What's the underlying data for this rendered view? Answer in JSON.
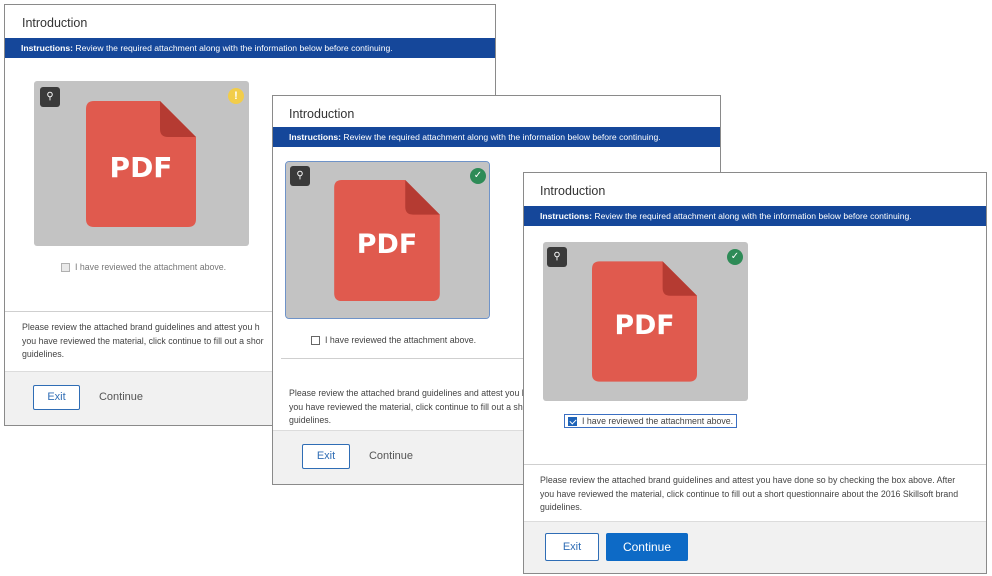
{
  "window_title": "Introduction",
  "instructions_label": "Instructions:",
  "instructions_text": " Review the required attachment along with the information below before continuing.",
  "pdf_label": "PDF",
  "checkbox_label": "I have reviewed the attachment above.",
  "description_w1": "Please review the attached brand guidelines and attest you h\nyou have reviewed the material, click continue to fill out a shor\nguidelines.",
  "description_w2": "Please review the attached brand guidelines and attest you ha\nyou have reviewed the material, click continue to fill out a sho\nguidelines.",
  "description_w3": "Please review the attached brand guidelines and attest you have done so by checking the box above. After\nyou have reviewed the material, click continue to fill out a short questionnaire about the 2016 Skillsoft brand\nguidelines.",
  "exit_label": "Exit",
  "continue_label": "Continue",
  "icons": {
    "zoom": "magnify-icon",
    "warning": "warning-icon",
    "checkmark": "check-circle-icon",
    "file": "pdf-file-icon"
  },
  "colors": {
    "instruction_bar": "#15479a",
    "pdf_red": "#e05a4e",
    "pdf_fold": "#b53b32",
    "preview_bg": "#c3c3c3",
    "primary_button": "#0d6ac6",
    "warning": "#f2cd4a",
    "success": "#2e8b57"
  },
  "windows": [
    {
      "state": "unreviewed",
      "checkbox_checked": false,
      "continue_enabled": false
    },
    {
      "state": "previewed",
      "checkbox_checked": false,
      "continue_enabled": false
    },
    {
      "state": "reviewed",
      "checkbox_checked": true,
      "continue_enabled": true
    }
  ]
}
